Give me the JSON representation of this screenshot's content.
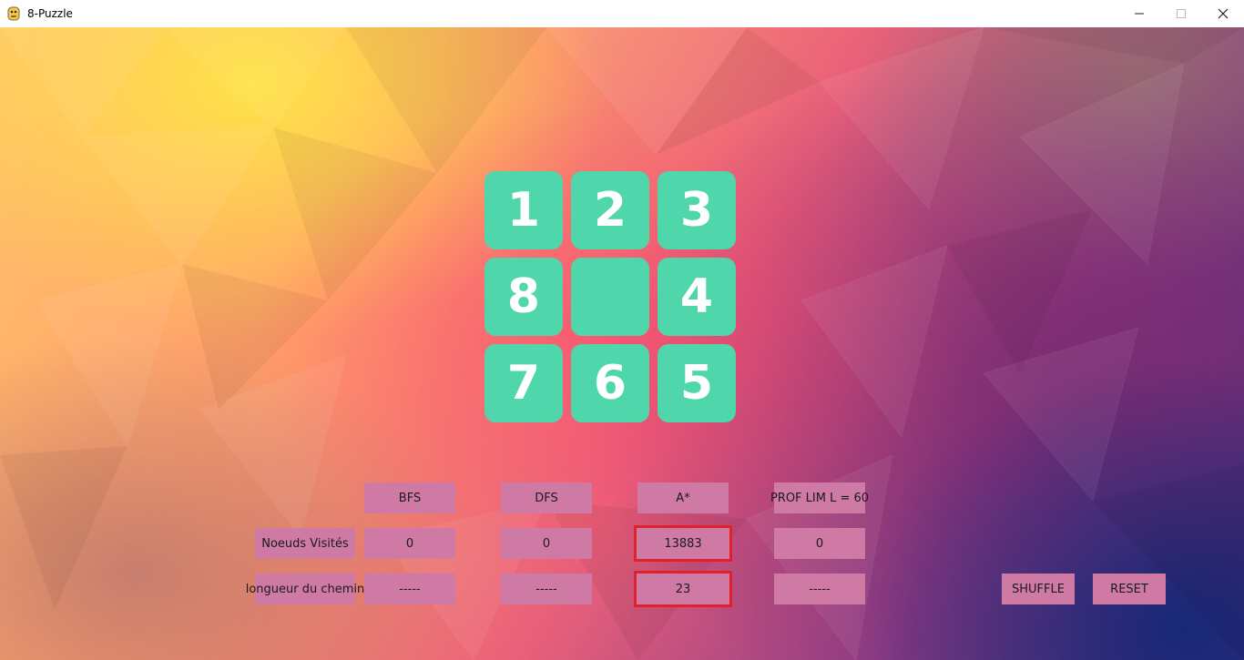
{
  "window": {
    "title": "8-Puzzle",
    "icon": "python-icon",
    "controls": [
      "minimize-icon",
      "maximize-icon",
      "close-icon"
    ]
  },
  "board": {
    "tiles": [
      {
        "value": "1"
      },
      {
        "value": "2"
      },
      {
        "value": "3"
      },
      {
        "value": "8"
      },
      {
        "value": ""
      },
      {
        "value": "4"
      },
      {
        "value": "7"
      },
      {
        "value": "6"
      },
      {
        "value": "5"
      }
    ],
    "tile_color": "#4fd7ab"
  },
  "algorithms": {
    "headers": [
      "BFS",
      "DFS",
      "A*",
      "PROF LIM L = 60"
    ],
    "rows": [
      {
        "label": "Noeuds Visités",
        "values": [
          "0",
          "0",
          "13883",
          "0"
        ]
      },
      {
        "label": "longueur du chemin",
        "values": [
          "-----",
          "-----",
          "23",
          "-----"
        ]
      }
    ],
    "highlight_color": "#e0202a",
    "cell_color": "#ce7aa4"
  },
  "buttons": {
    "shuffle": "SHUFFLE",
    "reset": "RESET"
  }
}
